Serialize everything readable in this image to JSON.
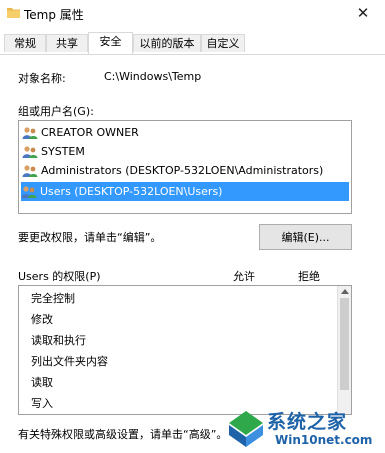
{
  "window": {
    "title": "Temp 属性",
    "close_glyph": "✕"
  },
  "tabs": [
    {
      "label": "常规",
      "active": false
    },
    {
      "label": "共享",
      "active": false
    },
    {
      "label": "安全",
      "active": true
    },
    {
      "label": "以前的版本",
      "active": false
    },
    {
      "label": "自定义",
      "active": false
    }
  ],
  "security": {
    "object_name_label": "对象名称:",
    "object_name_value": "C:\\Windows\\Temp",
    "group_label": "组或用户名(G):",
    "users": [
      {
        "name": "CREATOR OWNER",
        "selected": false,
        "icon": "user-group-icon"
      },
      {
        "name": "SYSTEM",
        "selected": false,
        "icon": "user-group-icon"
      },
      {
        "name": "Administrators (DESKTOP-532LOEN\\Administrators)",
        "selected": false,
        "icon": "user-group-icon"
      },
      {
        "name": "Users (DESKTOP-532LOEN\\Users)",
        "selected": true,
        "icon": "user-group-icon"
      }
    ],
    "change_hint": "要更改权限，请单击“编辑”。",
    "edit_button": "编辑(E)...",
    "permissions_label": "Users 的权限(P)",
    "allow_header": "允许",
    "deny_header": "拒绝",
    "permissions": [
      "完全控制",
      "修改",
      "读取和执行",
      "列出文件夹内容",
      "读取",
      "写入"
    ],
    "advanced_hint": "有关特殊权限或高级设置，请单击“高级”。"
  },
  "watermark": {
    "text": "系统之家",
    "url": "Win10net.com"
  },
  "colors": {
    "selection": "#3399ff",
    "watermark_blue": "#1e62a8"
  }
}
